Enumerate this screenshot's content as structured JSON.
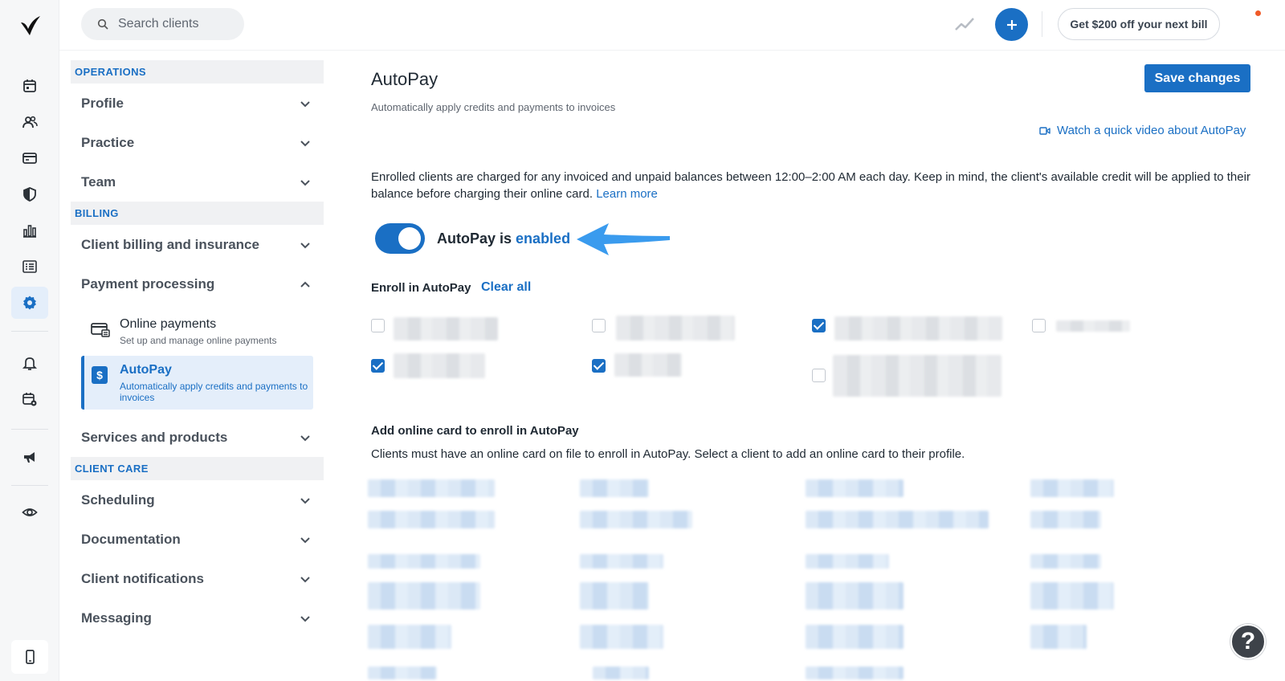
{
  "topbar": {
    "search_placeholder": "Search clients",
    "promo_label": "Get $200 off your next bill"
  },
  "rail": {
    "icons": [
      "calendar-icon",
      "clients-icon",
      "billing-card-icon",
      "shield-icon",
      "reports-icon",
      "list-icon",
      "settings-gear-icon",
      "bell-icon",
      "calendar-settings-icon",
      "megaphone-icon",
      "eye-icon",
      "mobile-icon"
    ]
  },
  "nav": {
    "operations_title": "OPERATIONS",
    "profile": "Profile",
    "practice": "Practice",
    "team": "Team",
    "billing_title": "BILLING",
    "client_billing": "Client billing and insurance",
    "payment_processing": "Payment processing",
    "online_payments": {
      "title": "Online payments",
      "desc": "Set up and manage online payments"
    },
    "autopay": {
      "title": "AutoPay",
      "desc": "Automatically apply credits and payments to invoices"
    },
    "services": "Services and products",
    "client_care_title": "CLIENT CARE",
    "scheduling": "Scheduling",
    "documentation": "Documentation",
    "client_notifications": "Client notifications",
    "messaging": "Messaging"
  },
  "main": {
    "title": "AutoPay",
    "subtitle": "Automatically apply credits and payments to invoices",
    "save_label": "Save changes",
    "video_link": "Watch a quick video about AutoPay",
    "description": "Enrolled clients are charged for any invoiced and unpaid balances between 12:00–2:00 AM each day. Keep in mind, the client's available credit will be applied to their balance before charging their online card.",
    "learn_more": "Learn more",
    "toggle_prefix": "AutoPay is",
    "toggle_state": "enabled",
    "toggle_on": true,
    "enroll_label": "Enroll in AutoPay",
    "clear_all": "Clear all",
    "enroll_checked": [
      false,
      false,
      true,
      false,
      true,
      true,
      false
    ],
    "add_card_title": "Add online card to enroll in AutoPay",
    "add_card_desc": "Clients must have an online card on file to enroll in AutoPay. Select a client to add an online card to their profile."
  },
  "colors": {
    "accent": "#1a6fc4",
    "notification": "#f05a28"
  },
  "help_label": "?"
}
